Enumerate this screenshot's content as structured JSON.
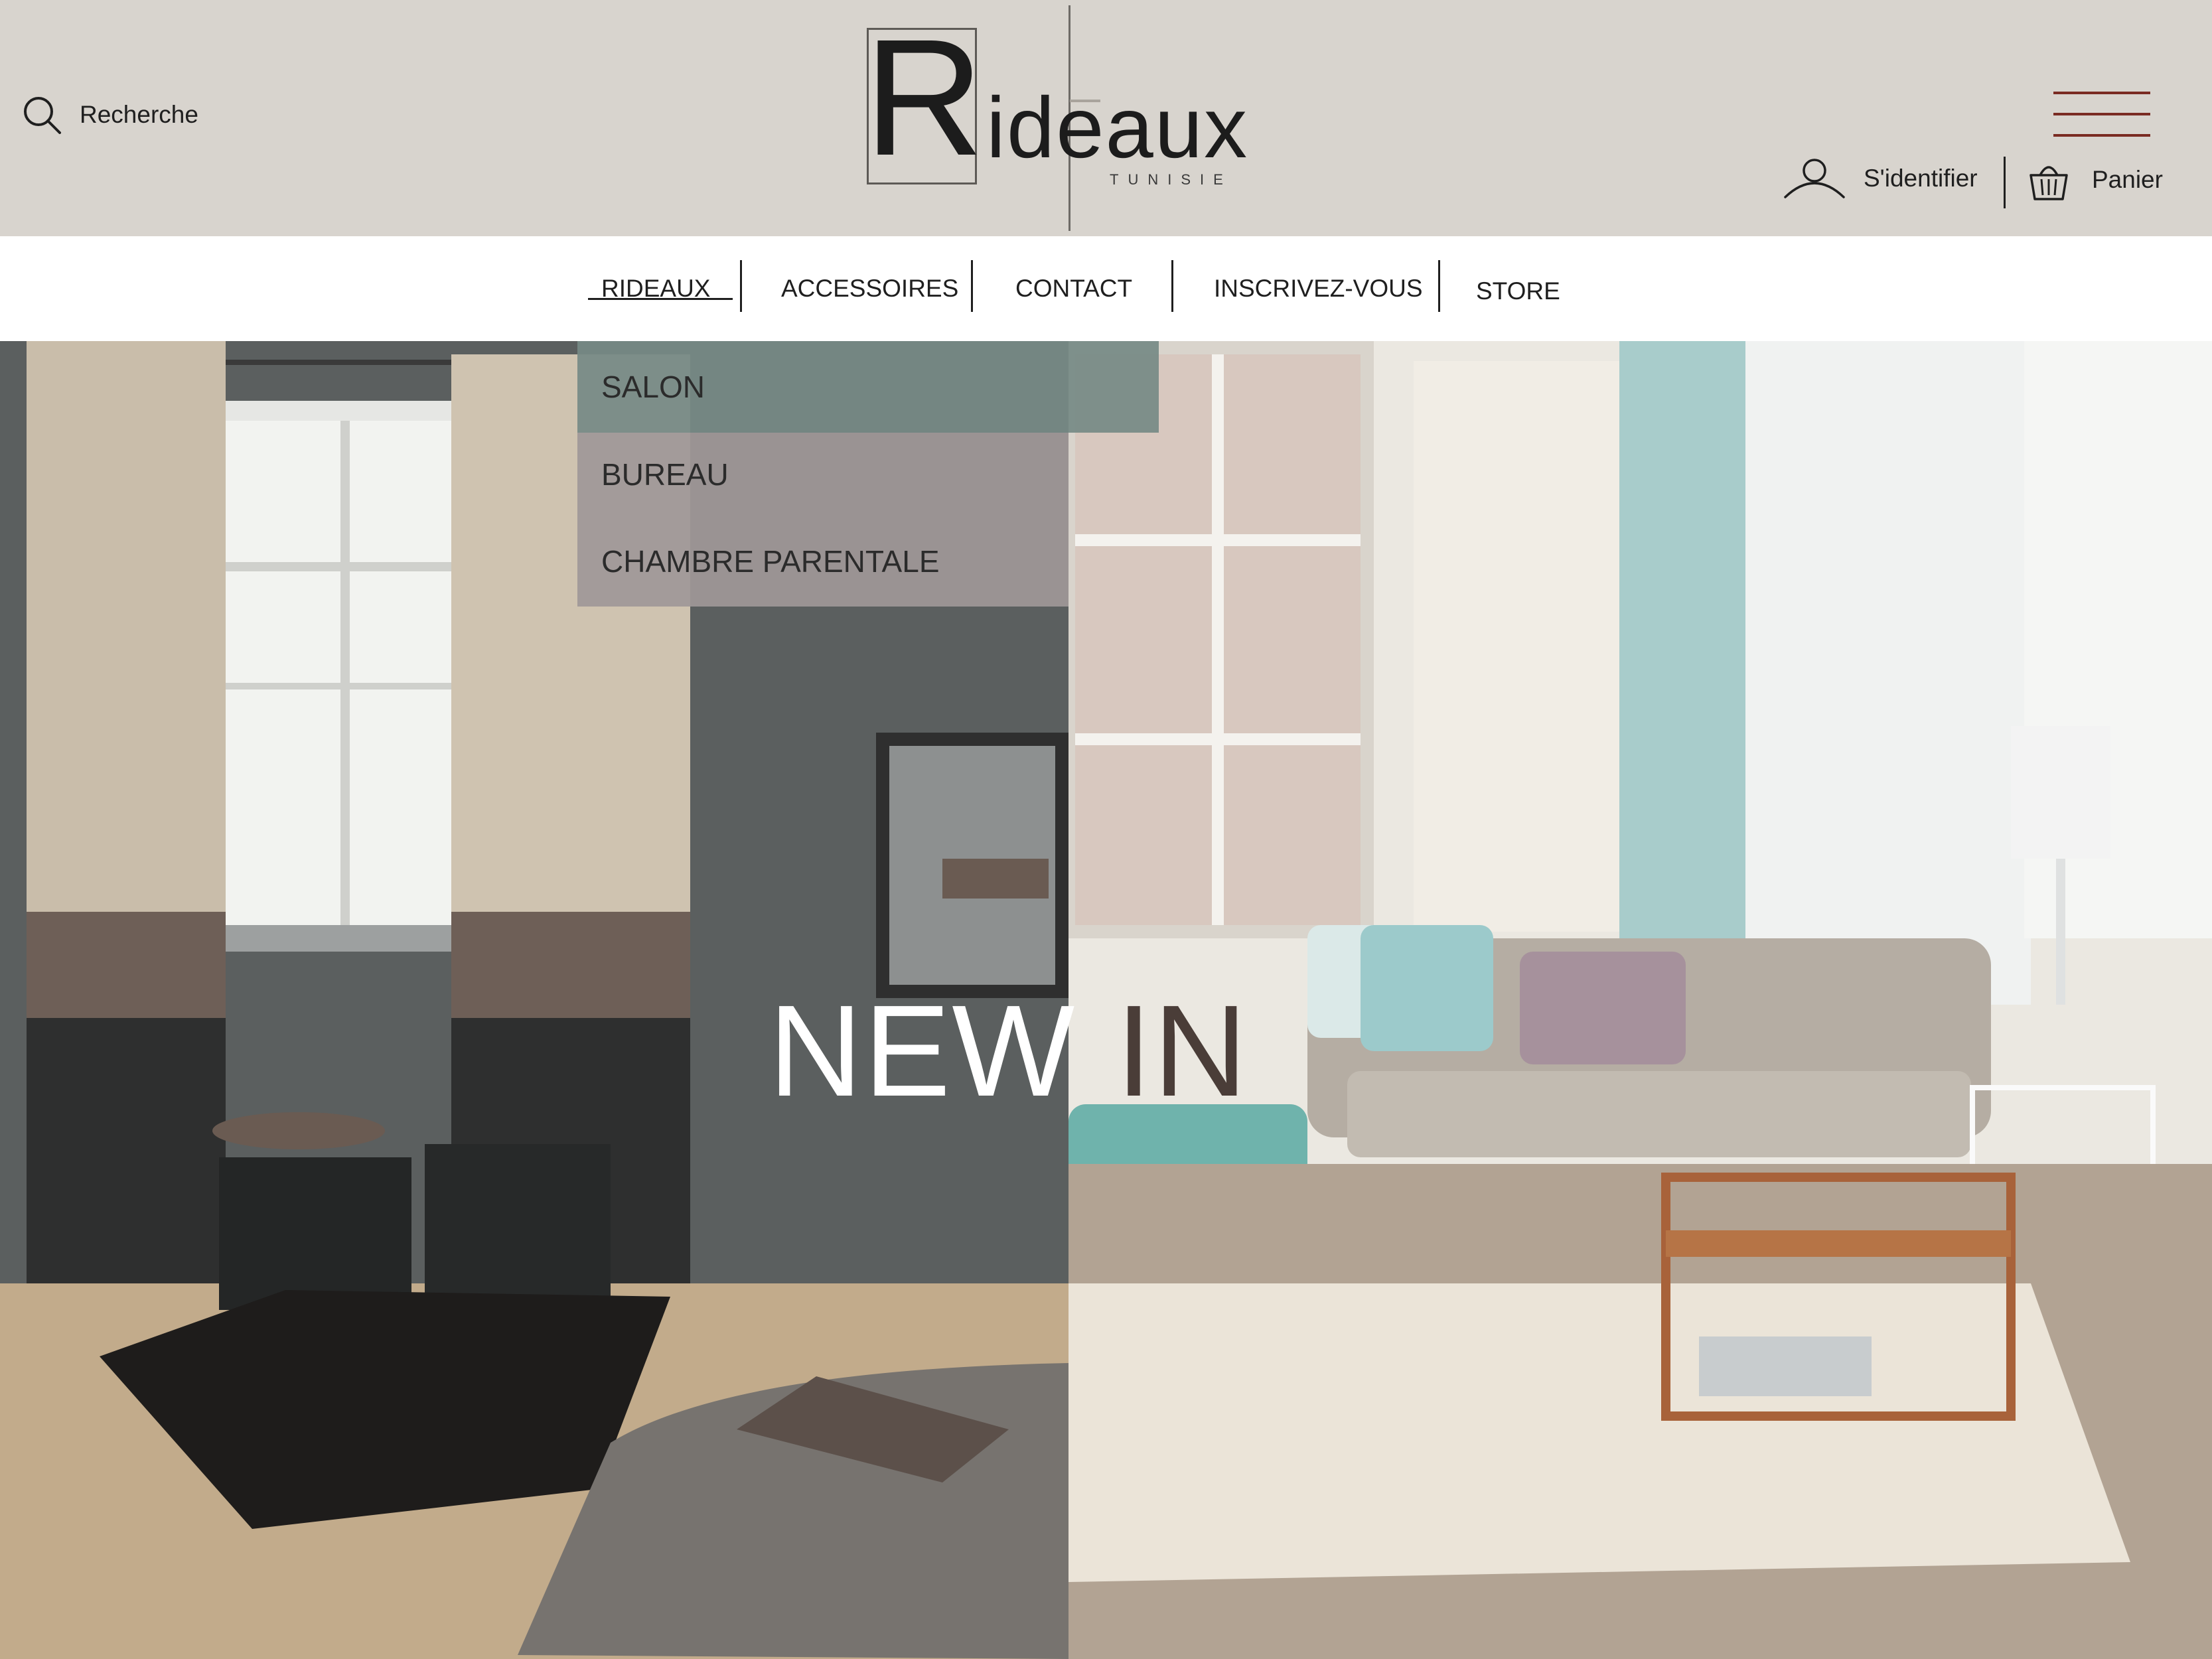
{
  "header": {
    "search_label": "Recherche",
    "logo": {
      "initial": "R",
      "word": "ideaux",
      "subtitle": "TUNISIE"
    },
    "account_label": "S'identifier",
    "cart_label": "Panier",
    "menu_icon": "hamburger-menu-icon"
  },
  "nav": {
    "items": [
      {
        "label": "RIDEAUX",
        "active": true
      },
      {
        "label": "ACCESSOIRES"
      },
      {
        "label": "CONTACT"
      },
      {
        "label": "INSCRIVEZ-VOUS"
      },
      {
        "label": "STORE"
      }
    ]
  },
  "dropdown": {
    "items": [
      {
        "label": "SALON",
        "active": true
      },
      {
        "label": "BUREAU"
      },
      {
        "label": "CHAMBRE PARENTALE"
      }
    ]
  },
  "hero": {
    "word1": "NEW",
    "word2": "IN"
  },
  "colors": {
    "header_bg": "#d8d4ce",
    "menu_accent": "#7a2b22",
    "dropdown_active": "#768a86",
    "dropdown_item": "#a09898",
    "hero_in_text": "#4a3d38"
  }
}
